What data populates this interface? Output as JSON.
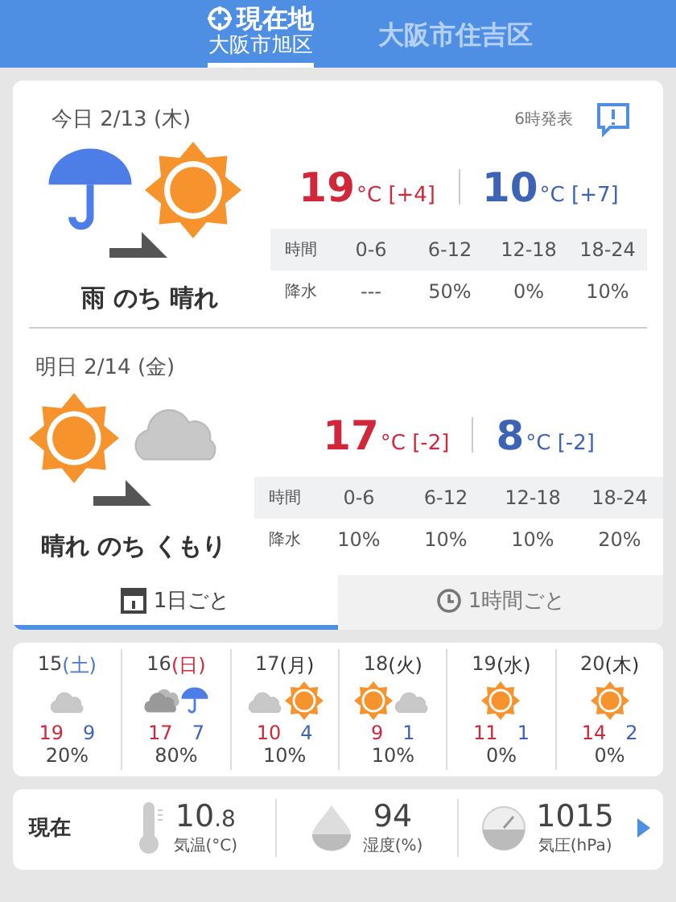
{
  "header": {
    "tabs": [
      {
        "title": "現在地",
        "subtitle": "大阪市旭区",
        "selected": true
      },
      {
        "title": "大阪市住吉区",
        "selected": false
      }
    ]
  },
  "forecast": {
    "days": [
      {
        "date": "今日 2/13 (木)",
        "issued": "6時発表",
        "weather": [
          {
            "kind": "rain"
          },
          {
            "kind": "sun"
          }
        ],
        "summary": "雨 のち 晴れ",
        "high": {
          "value": "19",
          "unit": "°C",
          "diff": "[+4]"
        },
        "low": {
          "value": "10",
          "unit": "°C",
          "diff": "[+7]"
        },
        "hours": [
          "時間",
          "0-6",
          "6-12",
          "12-18",
          "18-24"
        ],
        "precip": [
          "降水",
          "---",
          "50%",
          "0%",
          "10%"
        ]
      },
      {
        "date": "明日 2/14 (金)",
        "weather": [
          {
            "kind": "sun"
          },
          {
            "kind": "cloud"
          }
        ],
        "summary": "晴れ のち くもり",
        "high": {
          "value": "17",
          "unit": "°C",
          "diff": "[-2]"
        },
        "low": {
          "value": "8",
          "unit": "°C",
          "diff": "[-2]"
        },
        "hours": [
          "時間",
          "0-6",
          "6-12",
          "12-18",
          "18-24"
        ],
        "precip": [
          "降水",
          "10%",
          "10%",
          "10%",
          "20%"
        ]
      }
    ],
    "tabs": [
      {
        "label": "1日ごと",
        "selected": true
      },
      {
        "label": "1時間ごと",
        "selected": false
      }
    ]
  },
  "weekly": [
    {
      "day": "15",
      "weekday": "(土)",
      "color": "#4a78c8",
      "icons": [
        {
          "kind": "cloud"
        }
      ],
      "high": "19",
      "low": "9",
      "precip": "20%"
    },
    {
      "day": "16",
      "weekday": "(日)",
      "color": "#d0283a",
      "icons": [
        {
          "kind": "darkcloud"
        },
        {
          "kind": "umbrella"
        }
      ],
      "high": "17",
      "low": "7",
      "precip": "80%"
    },
    {
      "day": "17",
      "weekday": "(月)",
      "color": "#333333",
      "icons": [
        {
          "kind": "cloud"
        },
        {
          "kind": "sun"
        }
      ],
      "high": "10",
      "low": "4",
      "precip": "10%"
    },
    {
      "day": "18",
      "weekday": "(火)",
      "color": "#333333",
      "icons": [
        {
          "kind": "sun"
        },
        {
          "kind": "cloud"
        }
      ],
      "high": "9",
      "low": "1",
      "precip": "10%"
    },
    {
      "day": "19",
      "weekday": "(水)",
      "color": "#333333",
      "icons": [
        {
          "kind": "sun"
        }
      ],
      "high": "11",
      "low": "1",
      "precip": "0%"
    },
    {
      "day": "20",
      "weekday": "(木)",
      "color": "#333333",
      "icons": [
        {
          "kind": "sun"
        }
      ],
      "high": "14",
      "low": "2",
      "precip": "0%"
    }
  ],
  "current": {
    "label": "現在",
    "metrics": [
      {
        "kind": "temperature",
        "value": "10",
        "decimal": ".8",
        "label": "気温(°C)"
      },
      {
        "kind": "humidity",
        "value": "94",
        "label": "湿度(%)"
      },
      {
        "kind": "pressure",
        "value": "1015",
        "label": "気圧(hPa)"
      }
    ]
  }
}
